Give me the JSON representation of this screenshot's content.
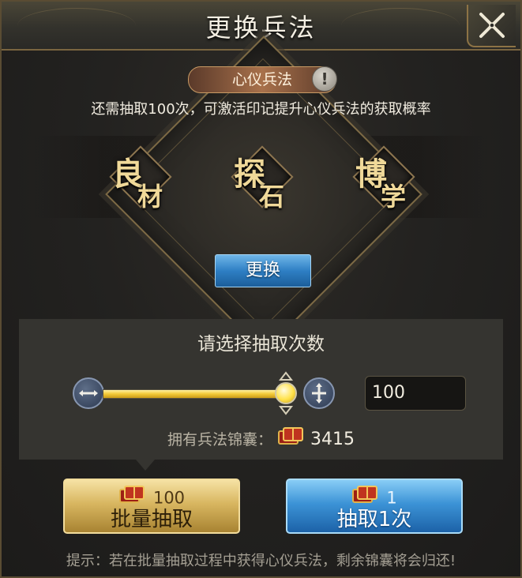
{
  "header": {
    "title": "更换兵法"
  },
  "badge": {
    "label": "心仪兵法",
    "info_glyph": "!"
  },
  "progress_hint": "还需抽取100次，可激活印记提升心仪兵法的获取概率",
  "seals": [
    {
      "big": "良",
      "small": "材"
    },
    {
      "big": "探",
      "small": "石"
    },
    {
      "big": "博",
      "small": "学"
    }
  ],
  "swap_button": "更换",
  "selector": {
    "title": "请选择抽取次数",
    "count": "100",
    "slider_fraction": 1.0,
    "own_label": "拥有兵法锦囊：",
    "own_count": "3415"
  },
  "actions": {
    "batch": {
      "cost": "100",
      "label": "批量抽取"
    },
    "single": {
      "cost": "1",
      "label": "抽取1次"
    }
  },
  "tip": "提示：若在批量抽取过程中获得心仪兵法，剩余锦囊将会归还!",
  "icons": {
    "close": "close-icon",
    "minus": "minus-icon",
    "plus": "plus-icon",
    "bag": "brocade-bag-icon",
    "info": "info-icon"
  },
  "colors": {
    "gold_accent": "#f3c937",
    "blue_button": "#3c93d6",
    "gold_button": "#d8b660"
  }
}
